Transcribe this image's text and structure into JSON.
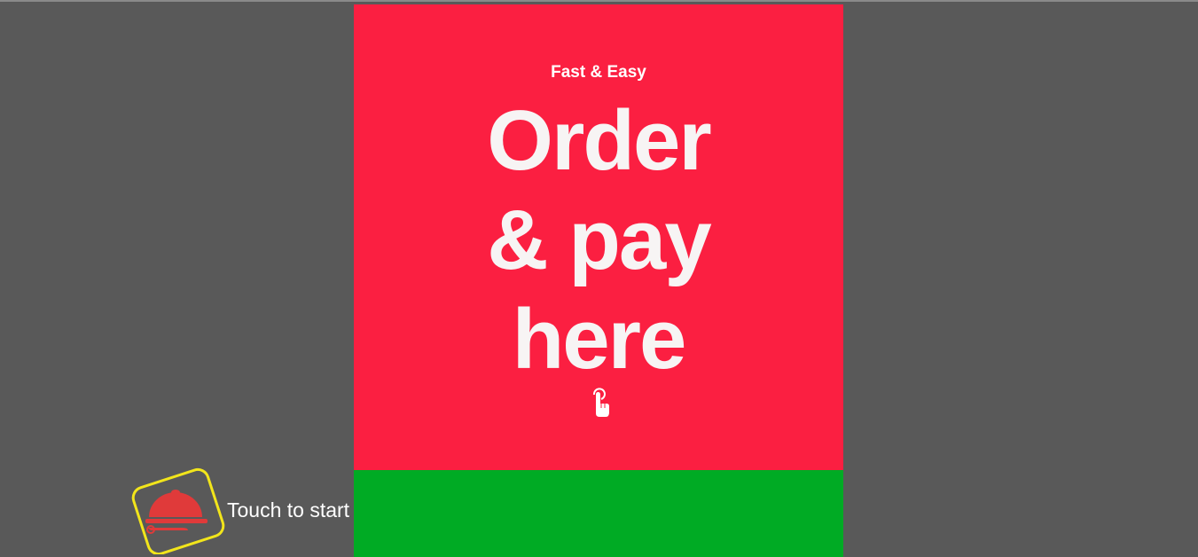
{
  "hero": {
    "tagline": "Fast & Easy",
    "headline_lines": [
      "Order",
      "& pay",
      "here"
    ],
    "pointer_icon": "hand-pointer-icon",
    "background_color": "#fb1f41",
    "text_color": "#f7f4f4"
  },
  "footer": {
    "cta_label": "Touch to start",
    "cta_icon": "serving-cloche-icon",
    "background_color": "#00ab24",
    "highlight_color": "#f2e51b",
    "icon_color": "#e03a3a"
  }
}
